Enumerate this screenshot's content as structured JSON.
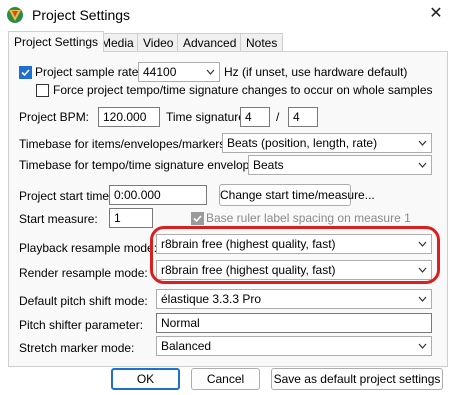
{
  "window": {
    "title": "Project Settings",
    "close": "✕"
  },
  "tabs": [
    "Project Settings",
    "Media",
    "Video",
    "Advanced",
    "Notes"
  ],
  "sample_rate": {
    "label": "Project sample rate:",
    "value": "44100",
    "note": "Hz (if unset, use hardware default)",
    "checked": true
  },
  "force_tempo": {
    "label": "Force project tempo/time signature changes to occur on whole samples",
    "checked": false
  },
  "bpm": {
    "label": "Project BPM:",
    "value": "120.000"
  },
  "time_signature": {
    "label": "Time signature",
    "numerator": "4",
    "slash": "/",
    "denominator": "4"
  },
  "timebase_items": {
    "label": "Timebase for items/envelopes/markers:",
    "value": "Beats (position, length, rate)"
  },
  "timebase_tempo": {
    "label": "Timebase for tempo/time signature envelope:",
    "value": "Beats"
  },
  "start_time": {
    "label": "Project start time:",
    "value": "0:00.000",
    "button": "Change start time/measure..."
  },
  "start_measure": {
    "label": "Start measure:",
    "value": "1"
  },
  "ruler_spacing": {
    "label": "Base ruler label spacing on measure 1",
    "checked": true
  },
  "playback_resample": {
    "label": "Playback resample mode:",
    "value": "r8brain free (highest quality, fast)"
  },
  "render_resample": {
    "label": "Render resample mode:",
    "value": "r8brain free (highest quality, fast)"
  },
  "pitch_shift": {
    "label": "Default pitch shift mode:",
    "value": "élastique 3.3.3 Pro"
  },
  "pitch_param": {
    "label": "Pitch shifter parameter:",
    "value": "Normal"
  },
  "stretch_marker": {
    "label": "Stretch marker mode:",
    "value": "Balanced"
  },
  "buttons": {
    "ok": "OK",
    "cancel": "Cancel",
    "save_default": "Save as default project settings"
  },
  "colors": {
    "accent": "#1e6fd0",
    "highlight": "#d91f1f"
  }
}
